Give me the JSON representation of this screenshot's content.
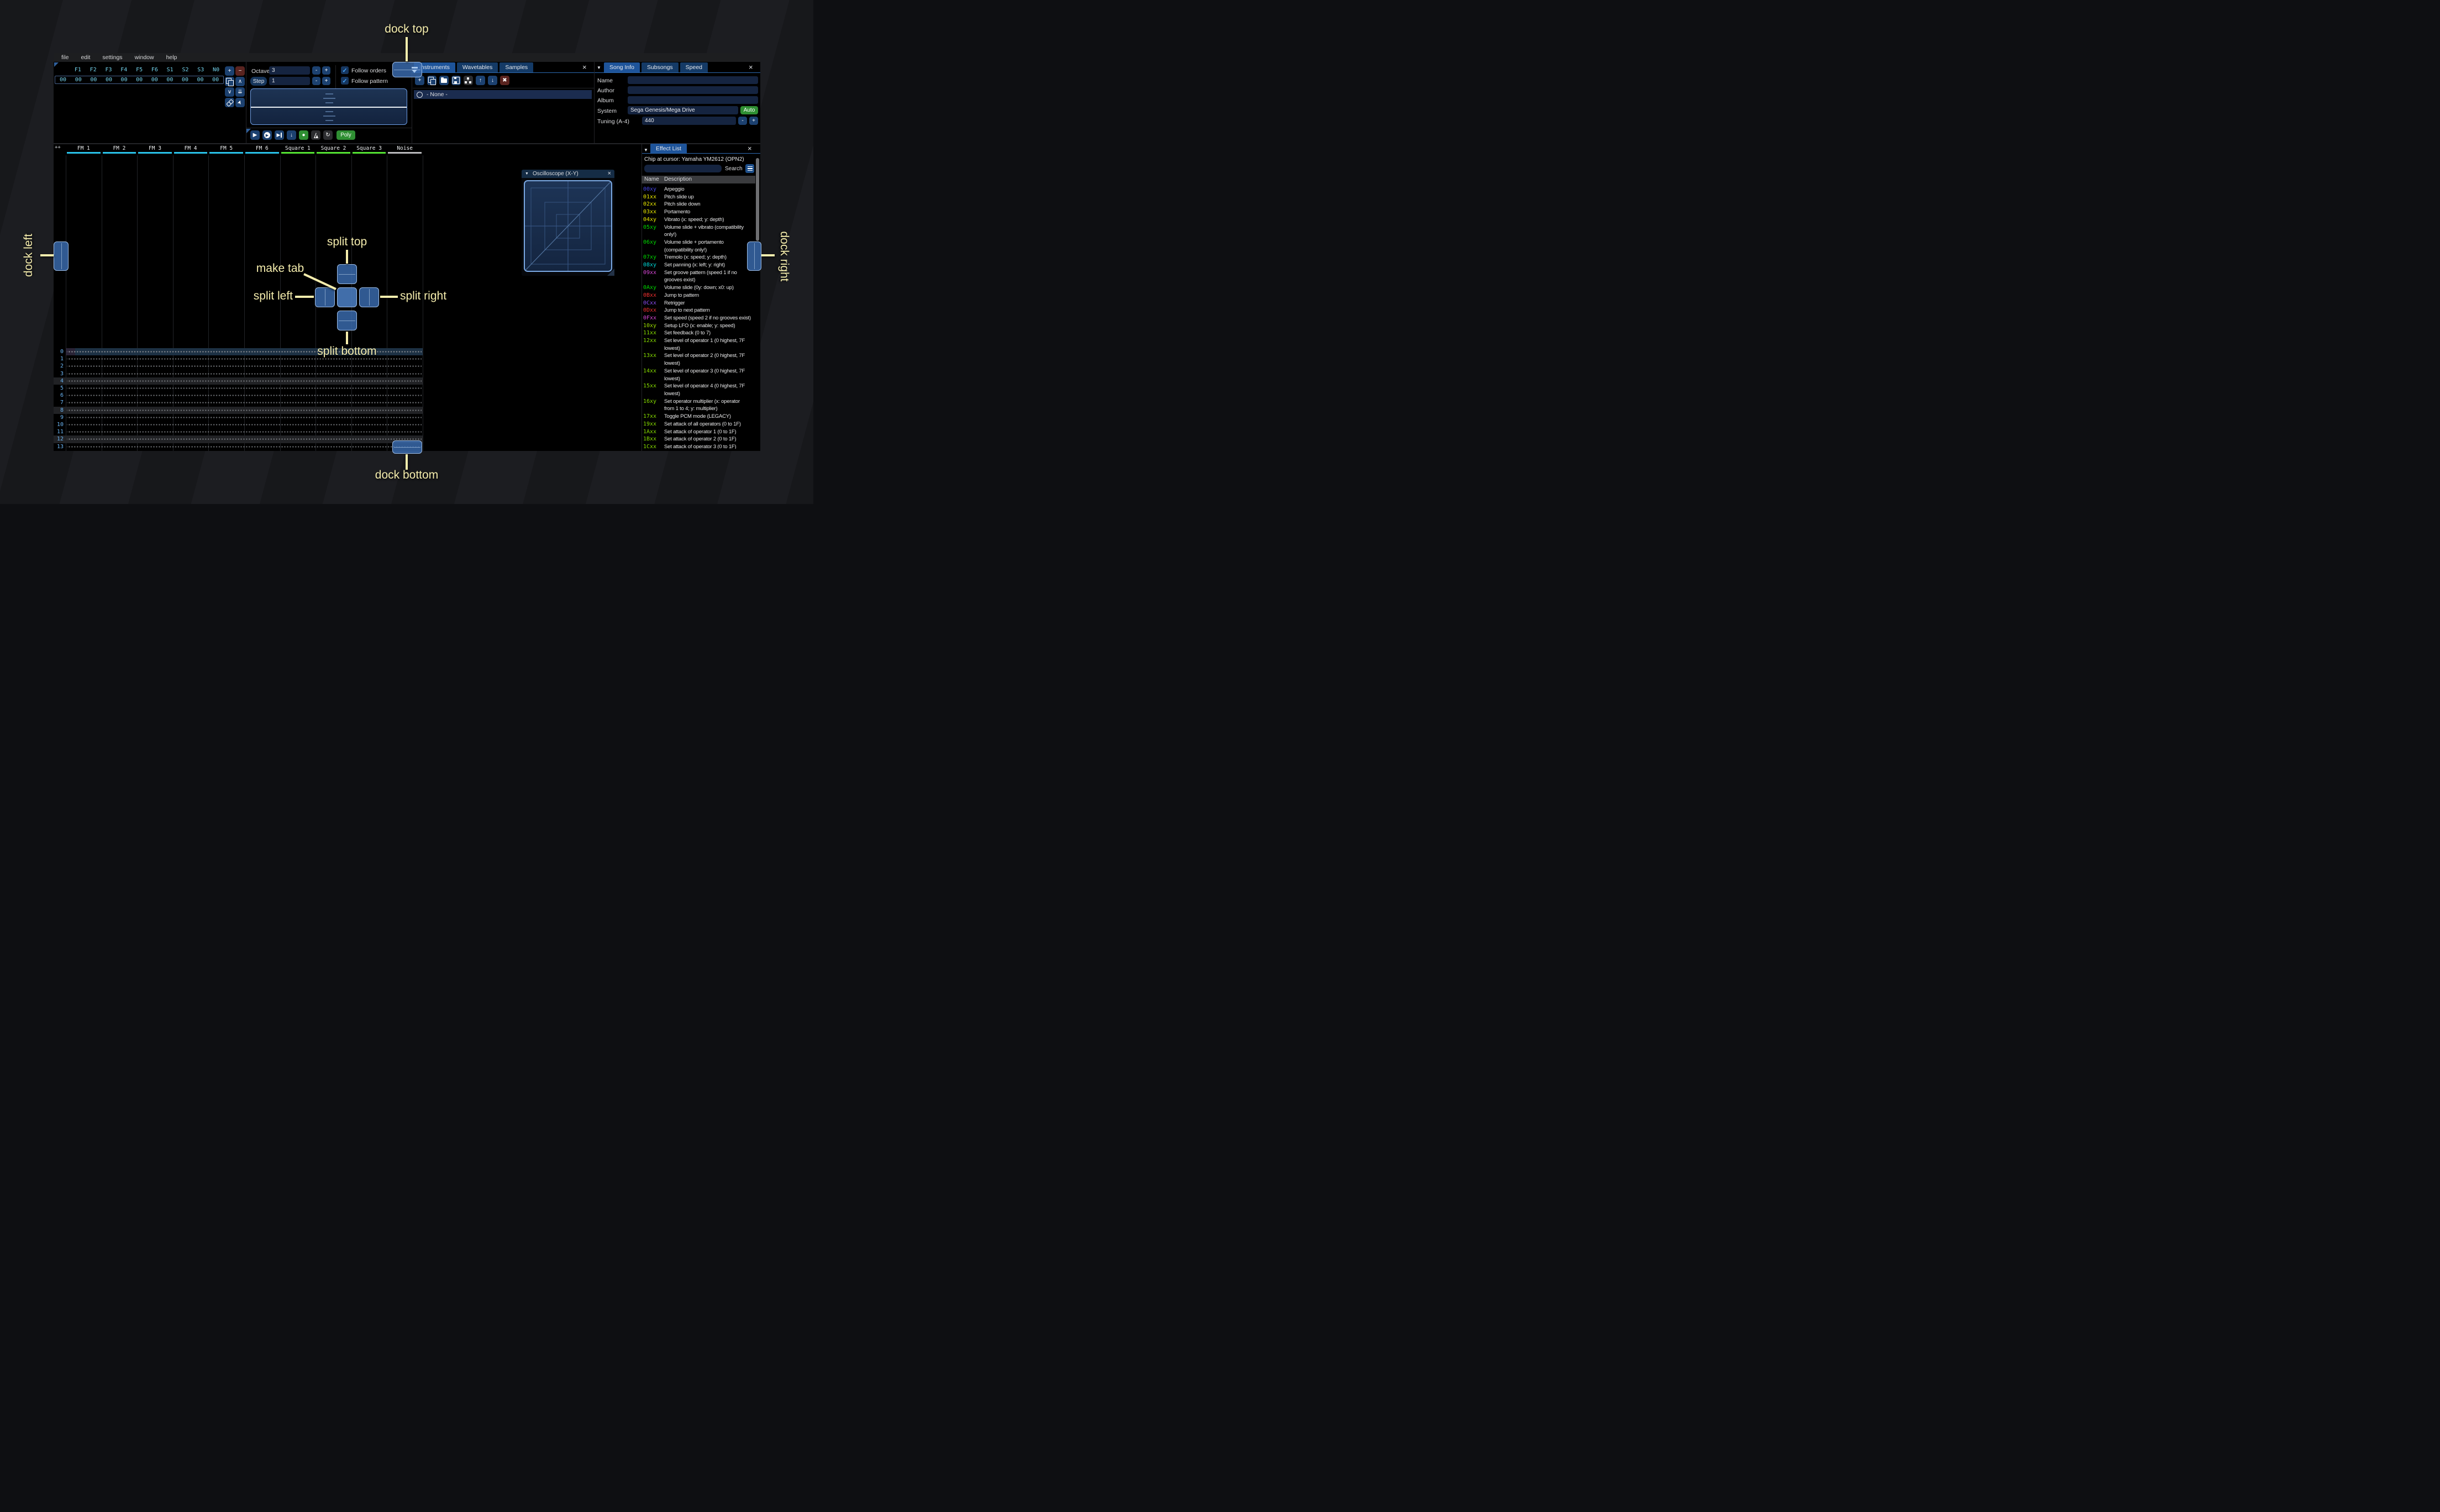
{
  "menu": [
    "file",
    "edit",
    "settings",
    "window",
    "help"
  ],
  "glyphs": {
    "close": "×",
    "collapse": "▼",
    "check": "✓",
    "minus": "-",
    "plus": "+",
    "up": "↑",
    "down": "↓",
    "chevron_up": "∧",
    "chevron_down": "∨",
    "dbl_down": "⇊",
    "play": "▶",
    "record": "●",
    "repeat": "↻",
    "delete": "✖",
    "add": "+",
    "remove": "−"
  },
  "orders": {
    "row_index": "00",
    "channels": [
      "F1",
      "F2",
      "F3",
      "F4",
      "F5",
      "F6",
      "S1",
      "S2",
      "S3",
      "N0"
    ],
    "values": [
      "00",
      "00",
      "00",
      "00",
      "00",
      "00",
      "00",
      "00",
      "00",
      "00"
    ]
  },
  "transport": {
    "octave_label": "Octave",
    "octave_value": "3",
    "step_label": "Step",
    "step_value": "1",
    "follow_orders": "Follow orders",
    "follow_pattern": "Follow pattern",
    "poly": "Poly"
  },
  "instruments": {
    "tabs": [
      "Instruments",
      "Wavetables",
      "Samples"
    ],
    "selected": "- None -"
  },
  "song_info": {
    "tabs": [
      "Song Info",
      "Subsongs",
      "Speed"
    ],
    "name_label": "Name",
    "author_label": "Author",
    "album_label": "Album",
    "system_label": "System",
    "system_value": "Sega Genesis/Mega Drive",
    "auto_button": "Auto",
    "tuning_label": "Tuning (A-4)",
    "tuning_value": "440"
  },
  "pattern": {
    "corner": "++",
    "channels": [
      {
        "label": "FM 1",
        "color": "#29c3ea"
      },
      {
        "label": "FM 2",
        "color": "#29c3ea"
      },
      {
        "label": "FM 3",
        "color": "#29c3ea"
      },
      {
        "label": "FM 4",
        "color": "#29c3ea"
      },
      {
        "label": "FM 5",
        "color": "#29c3ea"
      },
      {
        "label": "FM 6",
        "color": "#29c3ea"
      },
      {
        "label": "Square 1",
        "color": "#55e432"
      },
      {
        "label": "Square 2",
        "color": "#55e432"
      },
      {
        "label": "Square 3",
        "color": "#55e432"
      },
      {
        "label": "Noise",
        "color": "#bbbcbe"
      }
    ],
    "row_count": 22,
    "cursor_row": 0,
    "highlight_every": 4,
    "row_highlight_color": "#212225",
    "cursor_row_color": "#1d3144",
    "cursor_cell_color": "#292336"
  },
  "oscilloscope": {
    "title": "Oscilloscope (X-Y)"
  },
  "effect_list": {
    "tab": "Effect List",
    "chip_text": "Chip at cursor: Yamaha YM2612 (OPN2)",
    "search_label": "Search",
    "columns": [
      "Name",
      "Description"
    ],
    "entries": [
      {
        "code": "00xy",
        "color": "#4848e8",
        "lines": [
          "Arpeggio"
        ]
      },
      {
        "code": "01xx",
        "color": "#e8e800",
        "lines": [
          "Pitch slide up"
        ]
      },
      {
        "code": "02xx",
        "color": "#e8e800",
        "lines": [
          "Pitch slide down"
        ]
      },
      {
        "code": "03xx",
        "color": "#e8e800",
        "lines": [
          "Portamento"
        ]
      },
      {
        "code": "04xy",
        "color": "#e8e800",
        "lines": [
          "Vibrato (x: speed; y: depth)"
        ]
      },
      {
        "code": "05xy",
        "color": "#00d800",
        "lines": [
          "Volume slide + vibrato (compatibility",
          "only!)"
        ]
      },
      {
        "code": "06xy",
        "color": "#00d800",
        "lines": [
          "Volume slide + portamento",
          "(compatibility only!)"
        ]
      },
      {
        "code": "07xy",
        "color": "#00d800",
        "lines": [
          "Tremolo (x: speed; y: depth)"
        ]
      },
      {
        "code": "08xy",
        "color": "#00d8d8",
        "lines": [
          "Set panning (x: left; y: right)"
        ]
      },
      {
        "code": "09xx",
        "color": "#d848d8",
        "lines": [
          "Set groove pattern (speed 1 if no",
          "grooves exist)"
        ]
      },
      {
        "code": "0Axy",
        "color": "#00d800",
        "lines": [
          "Volume slide (0y: down; x0: up)"
        ]
      },
      {
        "code": "0Bxx",
        "color": "#f03030",
        "lines": [
          "Jump to pattern"
        ]
      },
      {
        "code": "0Cxx",
        "color": "#8a4cf0",
        "lines": [
          "Retrigger"
        ]
      },
      {
        "code": "0Dxx",
        "color": "#f03030",
        "lines": [
          "Jump to next pattern"
        ]
      },
      {
        "code": "0Fxx",
        "color": "#d848d8",
        "lines": [
          "Set speed (speed 2 if no grooves exist)"
        ]
      },
      {
        "code": "10xy",
        "color": "#9ade00",
        "lines": [
          "Setup LFO (x: enable; y: speed)"
        ]
      },
      {
        "code": "11xx",
        "color": "#86dc00",
        "lines": [
          "Set feedback (0 to 7)"
        ]
      },
      {
        "code": "12xx",
        "color": "#86dc00",
        "lines": [
          "Set level of operator 1 (0 highest, 7F",
          "lowest)"
        ]
      },
      {
        "code": "13xx",
        "color": "#86dc00",
        "lines": [
          "Set level of operator 2 (0 highest, 7F",
          "lowest)"
        ]
      },
      {
        "code": "14xx",
        "color": "#86dc00",
        "lines": [
          "Set level of operator 3 (0 highest, 7F",
          "lowest)"
        ]
      },
      {
        "code": "15xx",
        "color": "#86dc00",
        "lines": [
          "Set level of operator 4 (0 highest, 7F",
          "lowest)"
        ]
      },
      {
        "code": "16xy",
        "color": "#86dc00",
        "lines": [
          "Set operator multiplier (x: operator",
          "from 1 to 4; y: multiplier)"
        ]
      },
      {
        "code": "17xx",
        "color": "#86dc00",
        "lines": [
          "Toggle PCM mode (LEGACY)"
        ]
      },
      {
        "code": "19xx",
        "color": "#86dc00",
        "lines": [
          "Set attack of all operators (0 to 1F)"
        ]
      },
      {
        "code": "1Axx",
        "color": "#86dc00",
        "lines": [
          "Set attack of operator 1 (0 to 1F)"
        ]
      },
      {
        "code": "1Bxx",
        "color": "#86dc00",
        "lines": [
          "Set attack of operator 2 (0 to 1F)"
        ]
      },
      {
        "code": "1Cxx",
        "color": "#86dc00",
        "lines": [
          "Set attack of operator 3 (0 to 1F)"
        ]
      }
    ]
  },
  "overlay": {
    "labels": {
      "dock_top": "dock top",
      "dock_bottom": "dock bottom",
      "dock_left": "dock left",
      "dock_right": "dock right",
      "split_top": "split top",
      "split_bottom": "split bottom",
      "split_left": "split left",
      "split_right": "split right",
      "make_tab": "make tab"
    },
    "label_color": "#f5edad",
    "button_color": "#3a6caa"
  }
}
